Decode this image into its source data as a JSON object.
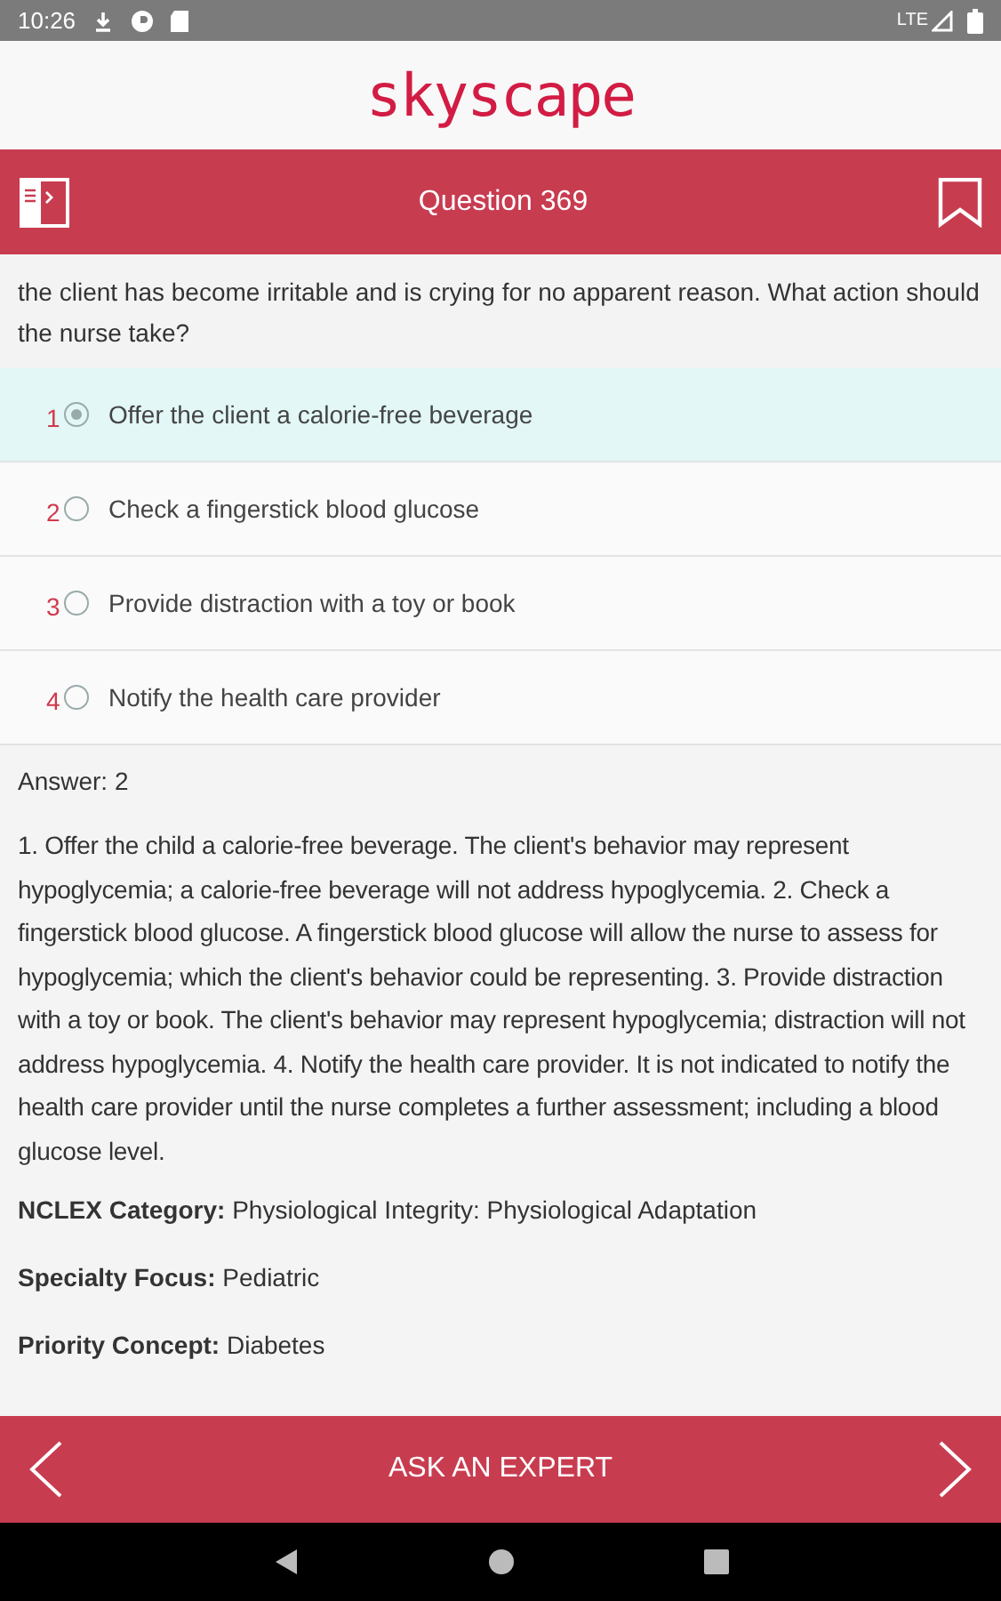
{
  "status_bar": {
    "time": "10:26",
    "network": "LTE"
  },
  "logo": "skyscape",
  "header": {
    "title": "Question 369"
  },
  "question": {
    "text": "the client has become irritable and is crying for no apparent reason. What action should the nurse take?"
  },
  "options": [
    {
      "number": "1",
      "text": "Offer the client a calorie-free beverage",
      "selected": true
    },
    {
      "number": "2",
      "text": "Check a fingerstick blood glucose",
      "selected": false
    },
    {
      "number": "3",
      "text": "Provide distraction with a toy or book",
      "selected": false
    },
    {
      "number": "4",
      "text": "Notify the health care provider",
      "selected": false
    }
  ],
  "answer": "Answer: 2",
  "explanation": "1. Offer the child a calorie-free beverage. The client's behavior may represent hypoglycemia; a calorie-free beverage will not address hypoglycemia. 2. Check a fingerstick blood glucose. A fingerstick blood glucose will allow the nurse to assess for hypoglycemia; which the client's behavior could be representing. 3. Provide distraction with a toy or book. The client's behavior may represent hypoglycemia; distraction will not address hypoglycemia. 4. Notify the health care provider. It is not indicated to notify the health care provider until the nurse completes a further assessment; including a blood glucose level.",
  "meta": [
    {
      "text": "**NCLEX Category:** Physiological Integrity: Physiological Adaptation"
    },
    {
      "text": "**Specialty Focus:** Pediatric"
    },
    {
      "text": "**Priority Concept:** Diabetes"
    }
  ],
  "footer": {
    "button": "ASK AN EXPERT"
  }
}
